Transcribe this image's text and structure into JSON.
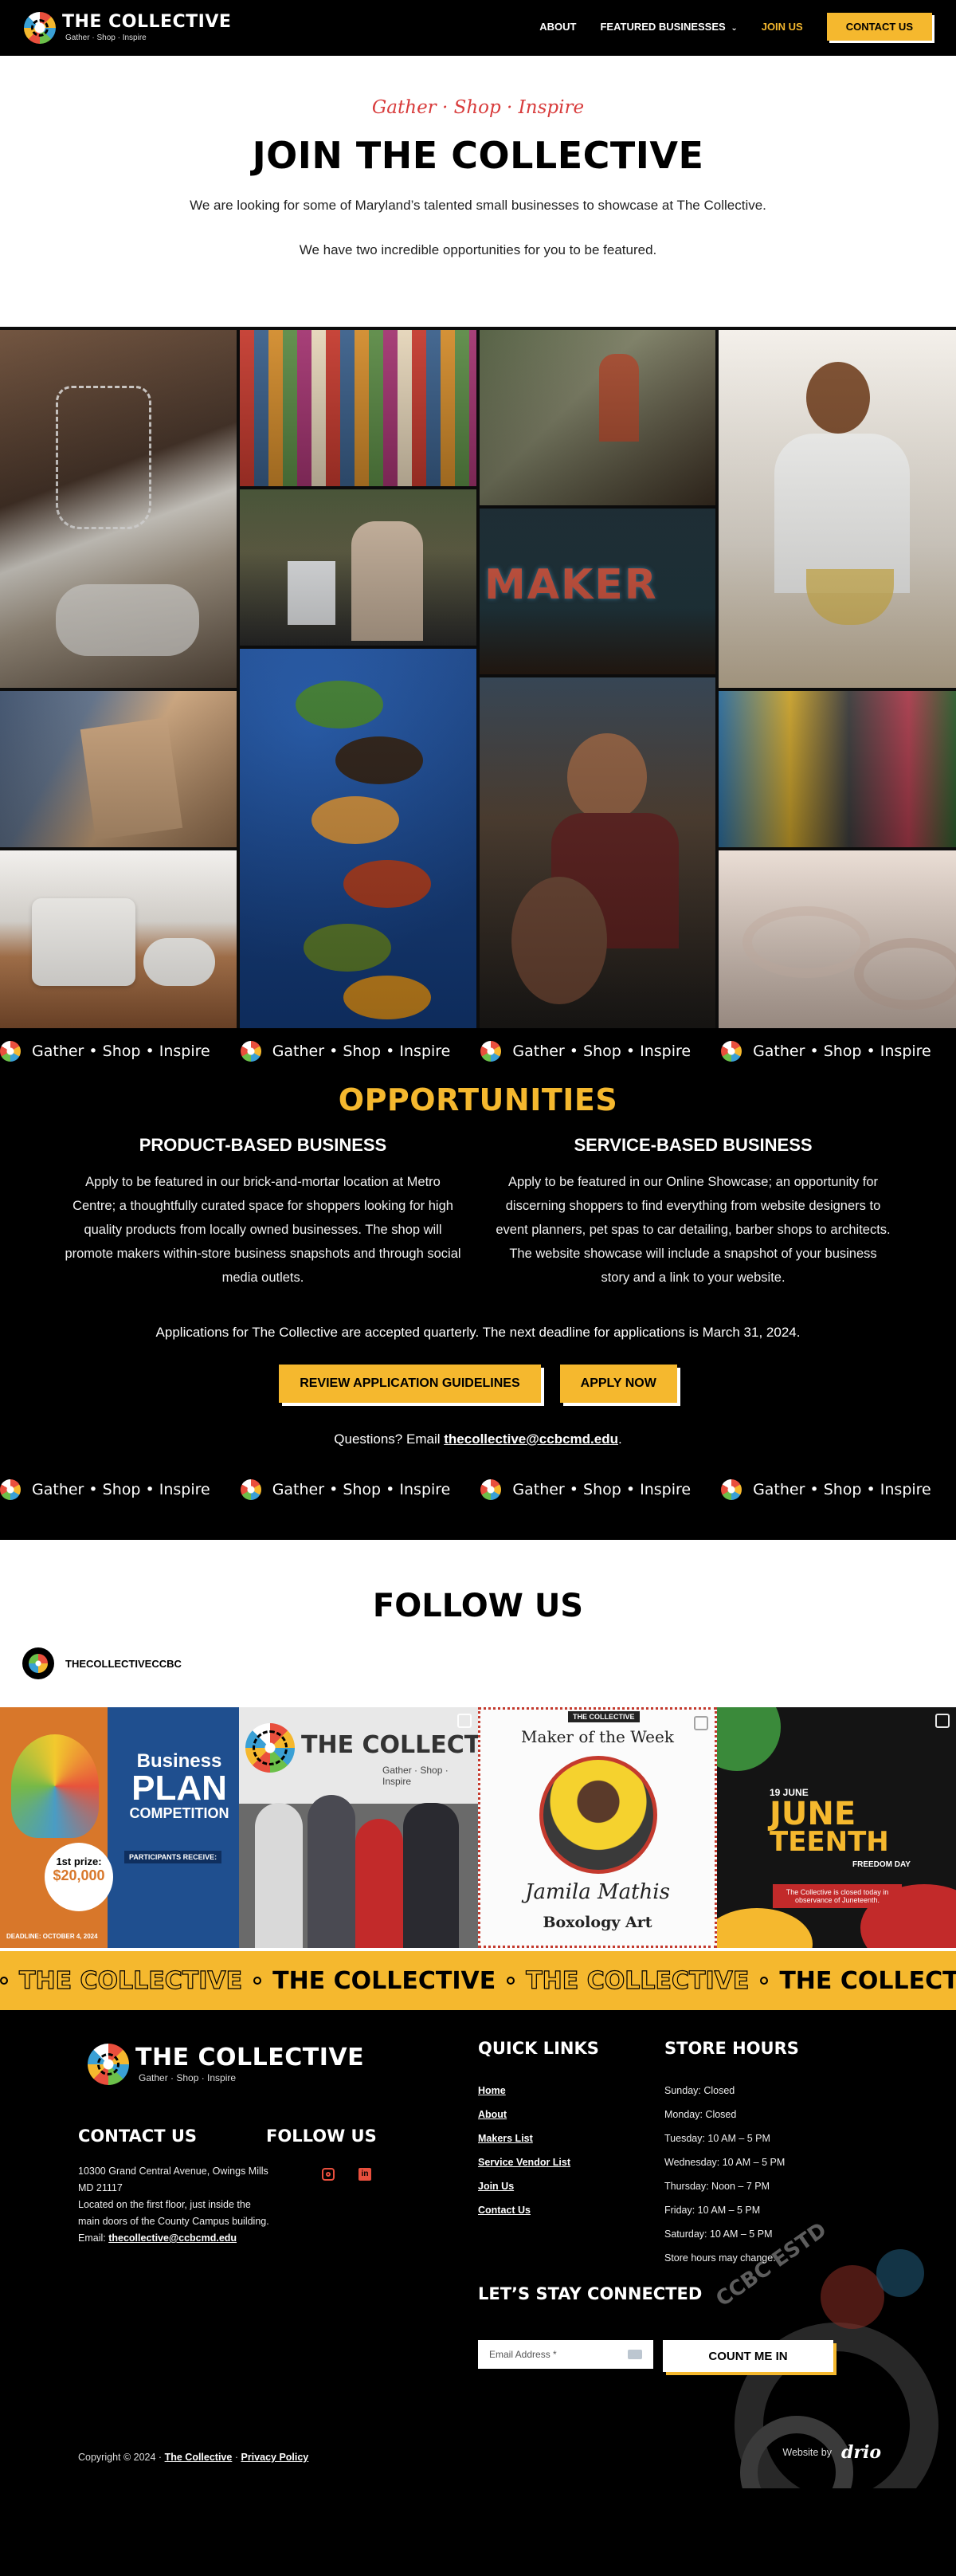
{
  "nav": {
    "logo_title": "THE COLLECTIVE",
    "logo_tagline": "Gather · Shop · Inspire",
    "links": [
      "ABOUT",
      "FEATURED BUSINESSES",
      "JOIN US"
    ],
    "dropdown_caret": "⌄",
    "cta": "CONTACT US"
  },
  "hero": {
    "tagline": "Gather · Shop · Inspire",
    "title": "JOIN THE COLLECTIVE",
    "p1": "We are looking for some of Maryland’s talented small businesses to showcase at The Collective.",
    "p2": "We have two incredible opportunities for you to be featured.",
    "maker_sign": "MAKER"
  },
  "marquee": {
    "text": "Gather • Shop • Inspire"
  },
  "opportunities": {
    "title": "OPPORTUNITIES",
    "product_title": "PRODUCT-BASED BUSINESS",
    "product_body": "Apply to be featured in our brick-and-mortar location at Metro Centre; a thoughtfully curated space for shoppers looking for high quality products from locally owned businesses. The shop will promote makers within-store business snapshots and through social media outlets.",
    "service_title": "SERVICE-BASED BUSINESS",
    "service_body": "Apply to be featured in our Online Showcase; an opportunity for discerning shoppers to find everything from website designers to event planners, pet spas to car detailing, barber shops to architects. The website showcase will include a snapshot of your business story and a link to your website.",
    "deadline": "Applications for The Collective are accepted quarterly. The next deadline for applications is March 31, 2024.",
    "btn_guidelines": "REVIEW APPLICATION GUIDELINES",
    "btn_apply": "APPLY NOW",
    "questions_prefix": "Questions? Email",
    "questions_email": "thecollective@ccbcmd.edu",
    "questions_suffix": "."
  },
  "follow": {
    "title": "FOLLOW US",
    "handle": "THECOLLECTIVECCBC",
    "post1": {
      "line1": "Business",
      "line2": "PLAN",
      "line3": "COMPETITION",
      "prize_label": "1st prize:",
      "prize": "$20,000",
      "participants": "PARTICIPANTS RECEIVE:",
      "footer": "DEADLINE: OCTOBER 4, 2024"
    },
    "post2": {
      "title": "THE COLLECTIVE",
      "tag": "Gather · Shop · Inspire"
    },
    "post3": {
      "header": "THE COLLECTIVE",
      "title": "Maker of the Week",
      "name": "Jamila Mathis",
      "business": "Boxology Art"
    },
    "post4": {
      "date": "19 JUNE",
      "big1": "JUNE",
      "big2": "TEENTH",
      "sub": "FREEDOM DAY",
      "note": "The Collective is closed today in observance of Juneteenth."
    }
  },
  "yellow_marquee": {
    "text": "THE COLLECTIVE"
  },
  "footer": {
    "logo_title": "THE COLLECTIVE",
    "logo_tagline": "Gather · Shop · Inspire",
    "contact_title": "CONTACT US",
    "address": "10300 Grand Central Avenue, Owings Mills MD 21117",
    "location_note": "Located on the first floor, just inside the main doors of the County Campus building.",
    "email_label": "Email:",
    "email": "thecollective@ccbcmd.edu",
    "follow_title": "FOLLOW US",
    "quick_title": "QUICK LINKS",
    "quick_links": [
      "Home",
      "About",
      "Makers List",
      "Service Vendor List",
      "Join Us",
      "Contact Us"
    ],
    "hours_title": "STORE HOURS",
    "hours": [
      "Sunday: Closed",
      "Monday: Closed",
      "Tuesday: 10 AM – 5 PM",
      "Wednesday: 10 AM – 5 PM",
      "Thursday: Noon – 7 PM",
      "Friday: 10 AM – 5 PM",
      "Saturday: 10 AM – 5 PM",
      "Store hours may change."
    ],
    "connect_title": "LET’S STAY CONNECTED",
    "email_placeholder": "Email Address *",
    "subscribe": "COUNT ME IN",
    "copyright_prefix": "Copyright © 2024 ·",
    "copyright_link1": "The Collective",
    "copyright_sep": "·",
    "copyright_link2": "Privacy Policy",
    "credit_label": "Website by",
    "credit_brand": "drio",
    "stamp_text": "CCBC ESTD"
  },
  "colors": {
    "accent_yellow": "#f5b82e",
    "accent_red": "#d83b3b",
    "background": "#000000"
  }
}
